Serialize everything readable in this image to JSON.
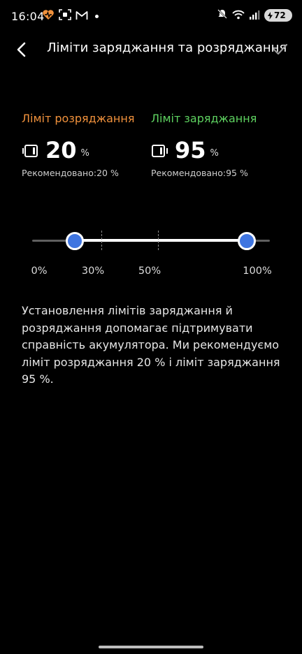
{
  "status_bar": {
    "time": "16:04",
    "battery_level": "72",
    "left_icons": [
      "heart-alert-icon",
      "screenshot-icon",
      "gmail-icon",
      "notification-dot-icon"
    ],
    "right_icons": [
      "mute-icon",
      "wifi-icon",
      "signal-icon",
      "battery-charging-icon"
    ]
  },
  "header": {
    "title": "Ліміти заряджання та розряджання"
  },
  "discharge": {
    "label": "Ліміт розряджання",
    "value": "20",
    "unit": "%",
    "recommended": "Рекомендовано:20 %",
    "color": "#f0913c"
  },
  "charge": {
    "label": "Ліміт заряджання",
    "value": "95",
    "unit": "%",
    "recommended": "Рекомендовано:95 %",
    "color": "#5ed260"
  },
  "slider": {
    "min_percent": 0,
    "max_percent": 100,
    "low_value_percent": 20,
    "high_value_percent": 95,
    "markers_percent": [
      30,
      50
    ],
    "scale_labels": [
      "0%",
      "30%",
      "50%",
      "100%"
    ],
    "thumb_color": "#3f75e0"
  },
  "description": "Установлення лімітів заряджання й розряджання допомагає підтримувати справність акумулятора. Ми рекомендуємо ліміт розряджання 20 % і ліміт заряджання 95 %."
}
